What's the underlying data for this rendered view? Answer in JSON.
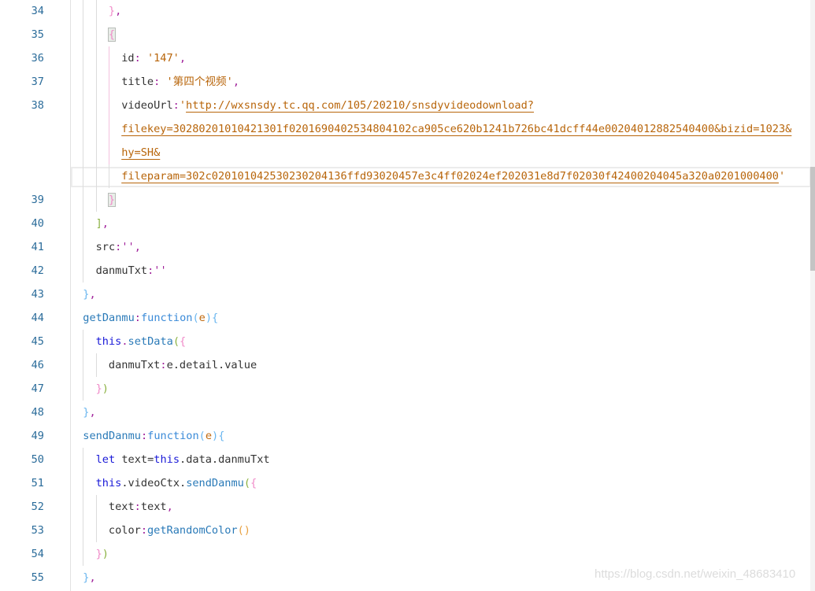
{
  "lines": [
    {
      "num": "34",
      "indent": 3,
      "tokens": [
        {
          "t": "}",
          "c": "bp"
        },
        {
          "t": ",",
          "c": "p"
        }
      ]
    },
    {
      "num": "35",
      "indent": 3,
      "tokens": [
        {
          "t": "{",
          "c": "bp bm"
        }
      ]
    },
    {
      "num": "36",
      "indent": 4,
      "pink": true,
      "tokens": [
        {
          "t": "id",
          "c": "k"
        },
        {
          "t": ": ",
          "c": "p"
        },
        {
          "t": "'147'",
          "c": "s"
        },
        {
          "t": ",",
          "c": "p"
        }
      ]
    },
    {
      "num": "37",
      "indent": 4,
      "pink": true,
      "tokens": [
        {
          "t": "title",
          "c": "k"
        },
        {
          "t": ": ",
          "c": "p"
        },
        {
          "t": "'第四个视频'",
          "c": "s"
        },
        {
          "t": ",",
          "c": "p"
        }
      ]
    },
    {
      "num": "38",
      "indent": 4,
      "pink": true,
      "tokens": [
        {
          "t": "videoUrl",
          "c": "k"
        },
        {
          "t": ":",
          "c": "p"
        },
        {
          "t": "'",
          "c": "s"
        },
        {
          "t": "http://wxsnsdy.tc.qq.com/105/20210/snsdyvideodownload?",
          "c": "u"
        }
      ]
    },
    {
      "num": "",
      "indent": 4,
      "pink": true,
      "tokens": [
        {
          "t": "filekey=30280201010421301f0201690402534804102ca905ce620b1241b726bc41dcff44e00204012882540400&bizid=1023&",
          "c": "u"
        }
      ]
    },
    {
      "num": "",
      "indent": 4,
      "pink": true,
      "tokens": [
        {
          "t": "hy=SH&",
          "c": "u"
        }
      ]
    },
    {
      "num": "",
      "indent": 4,
      "tokens": [
        {
          "t": "fileparam=302c020101042530230204136ffd93020457e3c4ff02024ef202031e8d7f02030f42400204045a320a0201000400",
          "c": "u"
        },
        {
          "t": "'",
          "c": "s"
        }
      ]
    },
    {
      "num": "39",
      "indent": 3,
      "tokens": [
        {
          "t": "}",
          "c": "bp bm"
        }
      ]
    },
    {
      "num": "40",
      "indent": 2,
      "tokens": [
        {
          "t": "]",
          "c": "bg"
        },
        {
          "t": ",",
          "c": "p"
        }
      ]
    },
    {
      "num": "41",
      "indent": 2,
      "tokens": [
        {
          "t": "src",
          "c": "k"
        },
        {
          "t": ":'',",
          "c": "p"
        }
      ]
    },
    {
      "num": "42",
      "indent": 2,
      "tokens": [
        {
          "t": "danmuTxt",
          "c": "k"
        },
        {
          "t": ":''",
          "c": "p"
        }
      ]
    },
    {
      "num": "43",
      "indent": 1,
      "tokens": [
        {
          "t": "}",
          "c": "bb"
        },
        {
          "t": ",",
          "c": "p"
        }
      ]
    },
    {
      "num": "44",
      "indent": 1,
      "tokens": [
        {
          "t": "getDanmu",
          "c": "fn"
        },
        {
          "t": ":",
          "c": "p"
        },
        {
          "t": "function",
          "c": "f"
        },
        {
          "t": "(",
          "c": "bb"
        },
        {
          "t": "e",
          "c": "arg"
        },
        {
          "t": ")",
          "c": "bb"
        },
        {
          "t": "{",
          "c": "bb"
        }
      ]
    },
    {
      "num": "45",
      "indent": 2,
      "tokens": [
        {
          "t": "this",
          "c": "kw"
        },
        {
          "t": ".",
          "c": "p"
        },
        {
          "t": "setData",
          "c": "fn"
        },
        {
          "t": "(",
          "c": "bg"
        },
        {
          "t": "{",
          "c": "bp"
        }
      ]
    },
    {
      "num": "46",
      "indent": 3,
      "tokens": [
        {
          "t": "danmuTxt",
          "c": "k"
        },
        {
          "t": ":",
          "c": "p"
        },
        {
          "t": "e.detail.value",
          "c": "k"
        }
      ]
    },
    {
      "num": "47",
      "indent": 2,
      "tokens": [
        {
          "t": "}",
          "c": "bp"
        },
        {
          "t": ")",
          "c": "bg"
        }
      ]
    },
    {
      "num": "48",
      "indent": 1,
      "tokens": [
        {
          "t": "}",
          "c": "bb"
        },
        {
          "t": ",",
          "c": "p"
        }
      ]
    },
    {
      "num": "49",
      "indent": 1,
      "tokens": [
        {
          "t": "sendDanmu",
          "c": "fn"
        },
        {
          "t": ":",
          "c": "p"
        },
        {
          "t": "function",
          "c": "f"
        },
        {
          "t": "(",
          "c": "bb"
        },
        {
          "t": "e",
          "c": "arg"
        },
        {
          "t": ")",
          "c": "bb"
        },
        {
          "t": "{",
          "c": "bb"
        }
      ]
    },
    {
      "num": "50",
      "indent": 2,
      "tokens": [
        {
          "t": "let ",
          "c": "kw"
        },
        {
          "t": "text=",
          "c": "k"
        },
        {
          "t": "this",
          "c": "kw"
        },
        {
          "t": ".data.danmuTxt",
          "c": "k"
        }
      ]
    },
    {
      "num": "51",
      "indent": 2,
      "tokens": [
        {
          "t": "this",
          "c": "kw"
        },
        {
          "t": ".videoCtx.",
          "c": "k"
        },
        {
          "t": "sendDanmu",
          "c": "fn"
        },
        {
          "t": "(",
          "c": "bg"
        },
        {
          "t": "{",
          "c": "bp"
        }
      ]
    },
    {
      "num": "52",
      "indent": 3,
      "tokens": [
        {
          "t": "text",
          "c": "k"
        },
        {
          "t": ":",
          "c": "p"
        },
        {
          "t": "text",
          "c": "k"
        },
        {
          "t": ",",
          "c": "p"
        }
      ]
    },
    {
      "num": "53",
      "indent": 3,
      "tokens": [
        {
          "t": "color",
          "c": "k"
        },
        {
          "t": ":",
          "c": "p"
        },
        {
          "t": "getRandomColor",
          "c": "fn"
        },
        {
          "t": "()",
          "c": "bo"
        }
      ]
    },
    {
      "num": "54",
      "indent": 2,
      "tokens": [
        {
          "t": "}",
          "c": "bp"
        },
        {
          "t": ")",
          "c": "bg"
        }
      ]
    },
    {
      "num": "55",
      "indent": 1,
      "tokens": [
        {
          "t": "}",
          "c": "bb"
        },
        {
          "t": ",",
          "c": "p"
        }
      ]
    }
  ],
  "watermark": "https://blog.csdn.net/weixin_48683410"
}
